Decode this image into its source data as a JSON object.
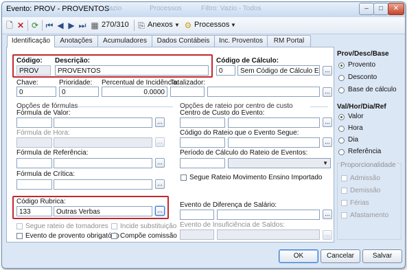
{
  "window": {
    "title": "Evento: PROV - PROVENTOS",
    "ghost_tabs": [
      "Vazio",
      "Processos",
      "Filtro: Vazio - Todos"
    ]
  },
  "toolbar": {
    "counter": "270/310",
    "anexos_label": "Anexos",
    "processos_label": "Processos"
  },
  "tabs": [
    "Identificação",
    "Anotações",
    "Acumuladores",
    "Dados Contábeis",
    "Inc. Proventos",
    "RM Portal"
  ],
  "active_tab": "Identificação",
  "identificacao": {
    "codigo_label": "Código:",
    "codigo_value": "PROV",
    "descricao_label": "Descrição:",
    "descricao_value": "PROVENTOS",
    "codigo_calculo_label": "Código de Cálculo:",
    "codigo_calculo_value": "0",
    "codigo_calculo_desc": "Sem Código de Cálculo Existente",
    "chave_label": "Chave:",
    "chave_value": "0",
    "prioridade_label": "Prioridade:",
    "prioridade_value": "0",
    "percentual_label": "Percentual de Incidência:",
    "percentual_value": "0.0000",
    "totalizador_label": "Totalizador:"
  },
  "formulas": {
    "group_label": "Opções de fórmulas",
    "valor_label": "Fórmula de Valor:",
    "hora_label": "Fórmula de Hora:",
    "referencia_label": "Fórmula de Referência:",
    "critica_label": "Fórmula de Crítica:"
  },
  "rateio": {
    "group_label": "Opções de rateio por centro de custo",
    "centro_label": "Centro de Custo do Evento:",
    "codigo_rateio_label": "Código do Rateio que o Evento Segue:",
    "periodo_label": "Período de Cálculo do Rateio de Eventos:",
    "segue_label": "Segue Rateio Movimento Ensino Importado"
  },
  "rubrica": {
    "label": "Código Rubrica:",
    "code": "133",
    "desc": "Outras Verbas"
  },
  "diferenca_label": "Evento de Diferença de Salário:",
  "insuficiencia_label": "Evento de Insuficiência de Saldos:",
  "checkboxes": {
    "segue_tomadores": "Segue rateio de tomadores",
    "incide_substituicao": "Incide substituição",
    "provento_obrigatorio": "Evento de provento obrigatório",
    "compoe_comissao": "Compõe comissão"
  },
  "side": {
    "prov_title": "Prov/Desc/Base",
    "prov_options": [
      "Provento",
      "Desconto",
      "Base de cálculo"
    ],
    "prov_selected": "Provento",
    "valor_title": "Val/Hor/Dia/Ref",
    "valor_options": [
      "Valor",
      "Hora",
      "Dia",
      "Referência"
    ],
    "valor_selected": "Valor",
    "prop_title": "Proporcionalidade",
    "prop_options": [
      "Admissão",
      "Demissão",
      "Férias",
      "Afastamento"
    ]
  },
  "footer": {
    "ok": "OK",
    "cancel": "Cancelar",
    "save": "Salvar"
  },
  "colors": {
    "highlight": "#c0282e",
    "window_bg": "#dce7f5",
    "accent": "#3a7bd5"
  }
}
